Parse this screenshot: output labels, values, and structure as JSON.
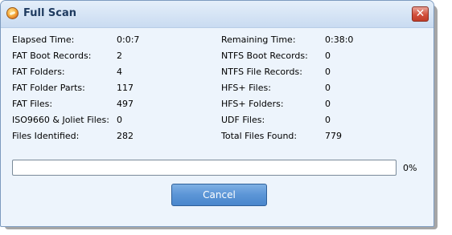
{
  "window": {
    "title": "Full Scan",
    "close_glyph": "✕",
    "icon": "app-scan-icon"
  },
  "stats_left": [
    {
      "label": "Elapsed Time:",
      "value": "0:0:7"
    },
    {
      "label": "FAT Boot Records:",
      "value": "2"
    },
    {
      "label": "FAT Folders:",
      "value": "4"
    },
    {
      "label": "FAT Folder Parts:",
      "value": "117"
    },
    {
      "label": "FAT Files:",
      "value": "497"
    },
    {
      "label": "ISO9660 & Joliet Files:",
      "value": "0"
    },
    {
      "label": "Files Identified:",
      "value": "282"
    }
  ],
  "stats_right": [
    {
      "label": "Remaining Time:",
      "value": "0:38:0"
    },
    {
      "label": "NTFS Boot Records:",
      "value": "0"
    },
    {
      "label": "NTFS File Records:",
      "value": "0"
    },
    {
      "label": "HFS+ Files:",
      "value": "0"
    },
    {
      "label": "HFS+ Folders:",
      "value": "0"
    },
    {
      "label": "UDF Files:",
      "value": "0"
    },
    {
      "label": "Total Files Found:",
      "value": "779"
    }
  ],
  "progress": {
    "percent_label": "0%",
    "fraction": 0
  },
  "buttons": {
    "cancel_label": "Cancel"
  },
  "colors": {
    "accent": "#5b95d6",
    "close": "#c03c29"
  }
}
